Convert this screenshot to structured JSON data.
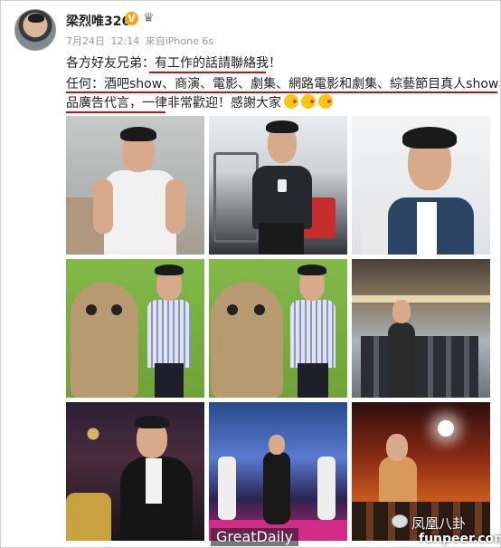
{
  "post": {
    "username": "梁烈唯326",
    "verified_badge": "V",
    "crown_glyph": "♛",
    "date": "7月24日",
    "time": "12:14",
    "source": "來自iPhone 6s",
    "line1_prefix": "各方好友兄弟：",
    "line1_highlight": "有工作的話請聯絡我！",
    "line2": "任何：酒吧show、商演、電影、劇集、網路電影和劇集、綜藝節目真人show、產",
    "line3": "品廣告代言，一律非常歡迎！感謝大家"
  },
  "photos": [
    {
      "name": "photo-1",
      "desc": "white-vest"
    },
    {
      "name": "photo-2",
      "desc": "gym-selfie"
    },
    {
      "name": "photo-3",
      "desc": "denim-selfie"
    },
    {
      "name": "photo-4",
      "desc": "mascot-left"
    },
    {
      "name": "photo-5",
      "desc": "mascot-right"
    },
    {
      "name": "photo-6",
      "desc": "mall-crowd"
    },
    {
      "name": "photo-7",
      "desc": "bar-mic"
    },
    {
      "name": "photo-8",
      "desc": "stage-show"
    },
    {
      "name": "photo-9",
      "desc": "club-crowd"
    }
  ],
  "watermarks": {
    "greatdaily": "GreatDaily",
    "phoenix": "凤凰八卦",
    "funpeer": "funpeer.com"
  },
  "colors": {
    "accent_red": "#c0141b",
    "meta_gray": "#999999",
    "badge_orange": "#f6a316"
  }
}
